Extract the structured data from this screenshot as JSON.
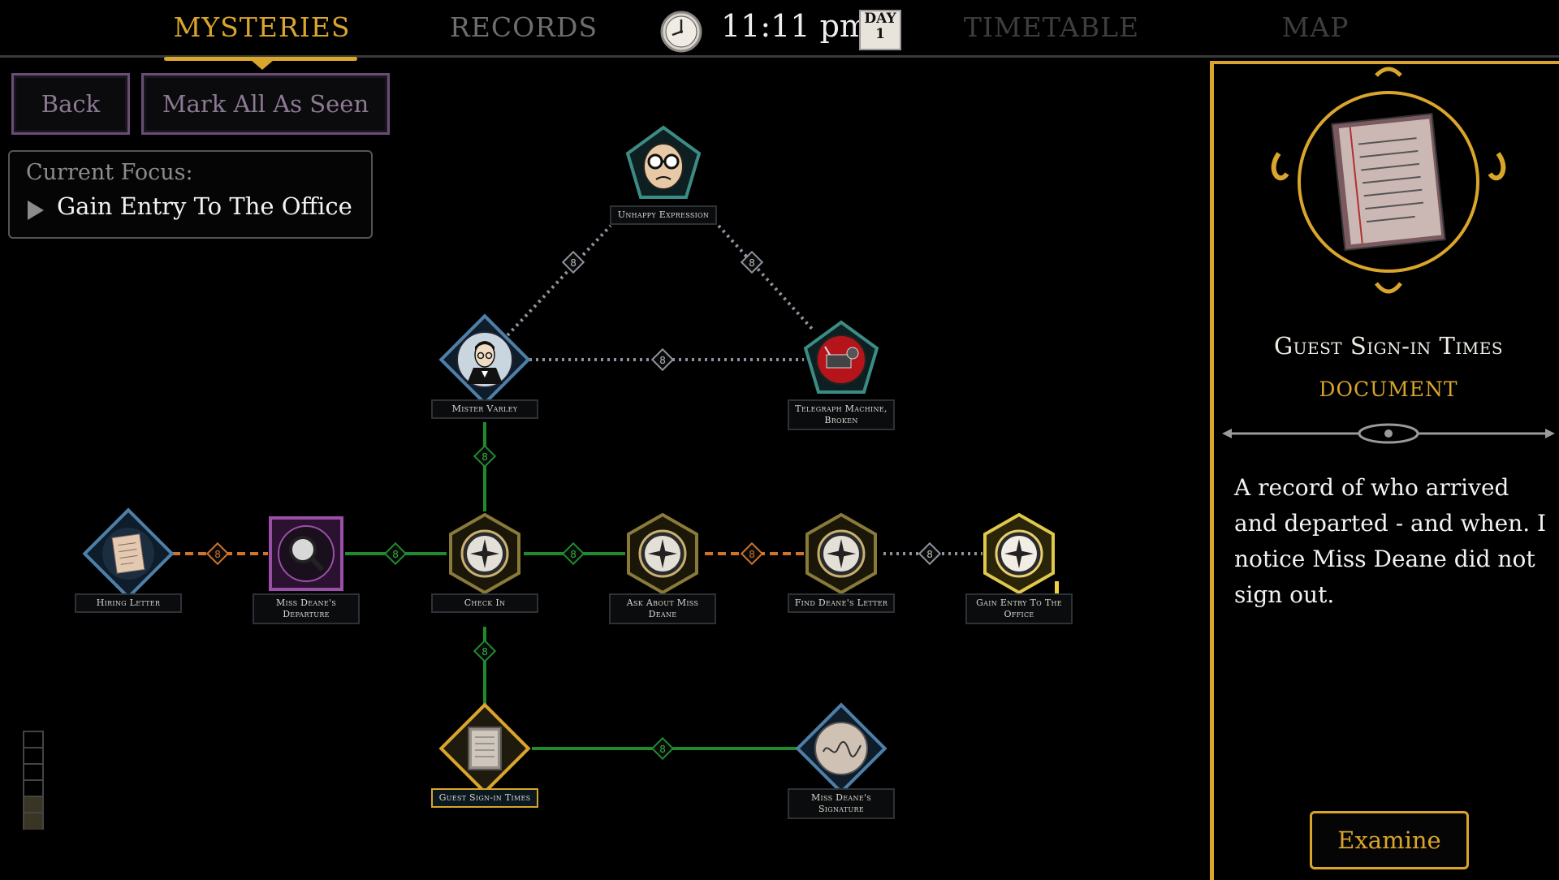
{
  "nav": {
    "tabs": [
      {
        "label": "MYSTERIES",
        "active": true
      },
      {
        "label": "RECORDS",
        "active": false
      },
      {
        "label": "TIMETABLE",
        "active": false
      },
      {
        "label": "MAP",
        "active": false
      }
    ],
    "time": "11:11 pm",
    "day_label": "DAY",
    "day_number": "1"
  },
  "controls": {
    "back_label": "Back",
    "mark_all_label": "Mark All As Seen"
  },
  "focus": {
    "label": "Current Focus:",
    "value": "Gain Entry To The Office"
  },
  "nodes": {
    "unhappy": {
      "label": "Unhappy Expression",
      "icon": "face-glasses-icon"
    },
    "varley": {
      "label": "Mister Varley",
      "icon": "portrait-man-icon"
    },
    "telegraph": {
      "label": "Telegraph Machine, Broken",
      "icon": "telegraph-icon"
    },
    "hiring": {
      "label": "Hiring Letter",
      "icon": "letter-icon"
    },
    "departure": {
      "label": "Miss Deane's Departure",
      "icon": "magnifier-icon"
    },
    "checkin": {
      "label": "Check In",
      "icon": "compass-icon"
    },
    "askabout": {
      "label": "Ask About Miss Deane",
      "icon": "compass-icon"
    },
    "findletter": {
      "label": "Find Deane's Letter",
      "icon": "compass-icon"
    },
    "gainentry": {
      "label": "Gain Entry To The Office",
      "icon": "compass-icon"
    },
    "signin": {
      "label": "Guest Sign-in Times",
      "icon": "ledger-icon"
    },
    "signature": {
      "label": "Miss Deane's Signature",
      "icon": "signature-icon"
    }
  },
  "selected": {
    "title": "Guest Sign-in Times",
    "type": "DOCUMENT",
    "description": "A record of who arrived and departed - and when. I notice Miss Deane did not sign out.",
    "examine_label": "Examine"
  },
  "colors": {
    "accent": "#d9a52c",
    "link_green": "#1f8a2e",
    "link_orange": "#d0742a",
    "link_gray": "#8e93a0"
  }
}
